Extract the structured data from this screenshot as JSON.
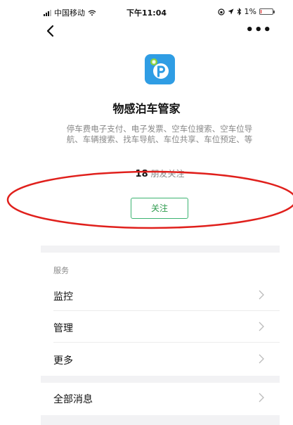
{
  "status_bar": {
    "carrier": "中国移动",
    "time": "下午11:04",
    "battery": "1%"
  },
  "nav": {
    "more": "•••"
  },
  "app": {
    "name": "物感泊车管家",
    "description": "停车费电子支付、电子发票、空车位搜索、空车位导航、车辆搜索、找车导航、车位共享、车位预定、等",
    "followers_count": "18",
    "followers_text": " 朋友关注",
    "follow_button": "关注",
    "logo_color": "#2f9de4"
  },
  "services": {
    "title": "服务",
    "items": [
      {
        "label": "监控"
      },
      {
        "label": "管理"
      },
      {
        "label": "更多"
      }
    ]
  },
  "all_messages": "全部消息",
  "colors": {
    "annotation_ellipse": "#e0201c",
    "follow_green": "#3cb371"
  }
}
